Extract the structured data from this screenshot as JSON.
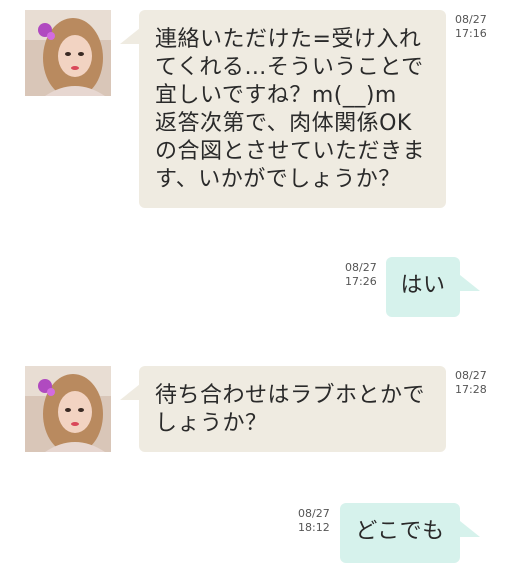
{
  "messages": [
    {
      "direction": "incoming",
      "text": "連絡いただけた=受け入れ\nてくれる…そういうことで\n宜しいですね？m(__)m\n返答次第で、肉体関係OK\nの合図とさせていただきま\nす、いかがでしょうか？",
      "date": "08/27",
      "time": "17:16"
    },
    {
      "direction": "outgoing",
      "text": "はい",
      "date": "08/27",
      "time": "17:26"
    },
    {
      "direction": "incoming",
      "text": "待ち合わせはラブホとかで\nしょうか？",
      "date": "08/27",
      "time": "17:28"
    },
    {
      "direction": "outgoing",
      "text": "どこでも",
      "date": "08/27",
      "time": "18:12"
    }
  ],
  "colors": {
    "incoming_bubble": "#efebe1",
    "outgoing_bubble": "#d6f2ec",
    "timestamp_text": "#555555"
  },
  "icons": {
    "avatar": "contact-avatar-photo"
  }
}
